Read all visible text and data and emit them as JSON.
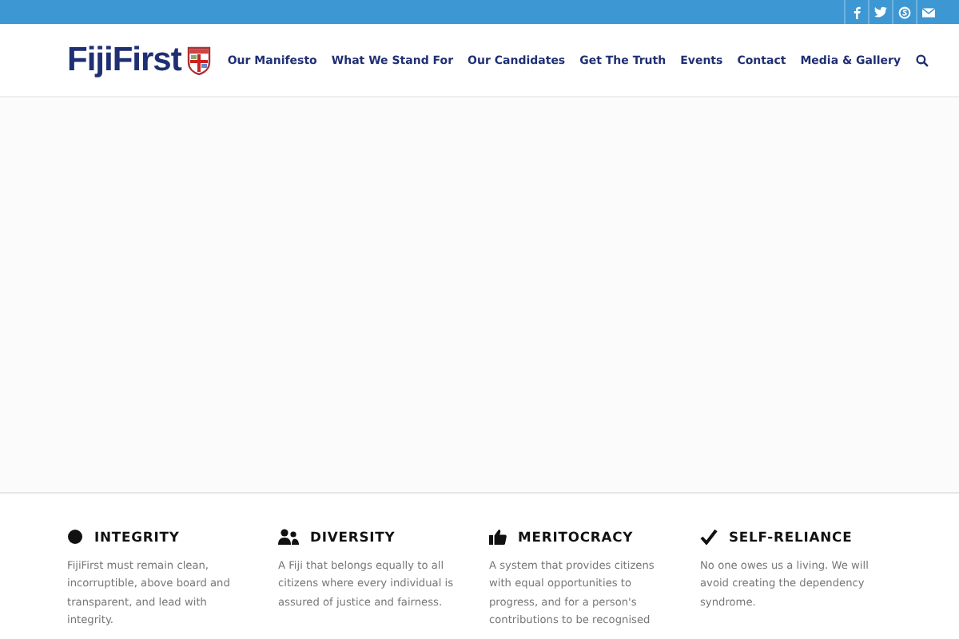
{
  "header": {
    "logo": "FijiFirst",
    "nav": [
      {
        "label": "Our Manifesto"
      },
      {
        "label": "What We Stand For"
      },
      {
        "label": "Our Candidates"
      },
      {
        "label": "Get The Truth"
      },
      {
        "label": "Events"
      },
      {
        "label": "Contact"
      },
      {
        "label": "Media & Gallery"
      }
    ]
  },
  "social": [
    {
      "kind": "facebook"
    },
    {
      "kind": "twitter"
    },
    {
      "kind": "skype"
    },
    {
      "kind": "mail"
    }
  ],
  "values": [
    {
      "kind": "circle",
      "title": "INTEGRITY",
      "text": "FijiFirst must remain clean, incorruptible, above board and transparent, and lead with integrity."
    },
    {
      "kind": "people",
      "title": "DIVERSITY",
      "text": "A Fiji that belongs equally to all citizens where every individual is assured of justice and fairness."
    },
    {
      "kind": "thumb",
      "title": "MERITOCRACY",
      "text": "A system that provides citizens with equal opportunities to progress, and for a person's contributions to be recognised"
    },
    {
      "kind": "check",
      "title": "SELF-RELIANCE",
      "text": "No one owes us a living. We will avoid creating the dependency syndrome."
    }
  ]
}
